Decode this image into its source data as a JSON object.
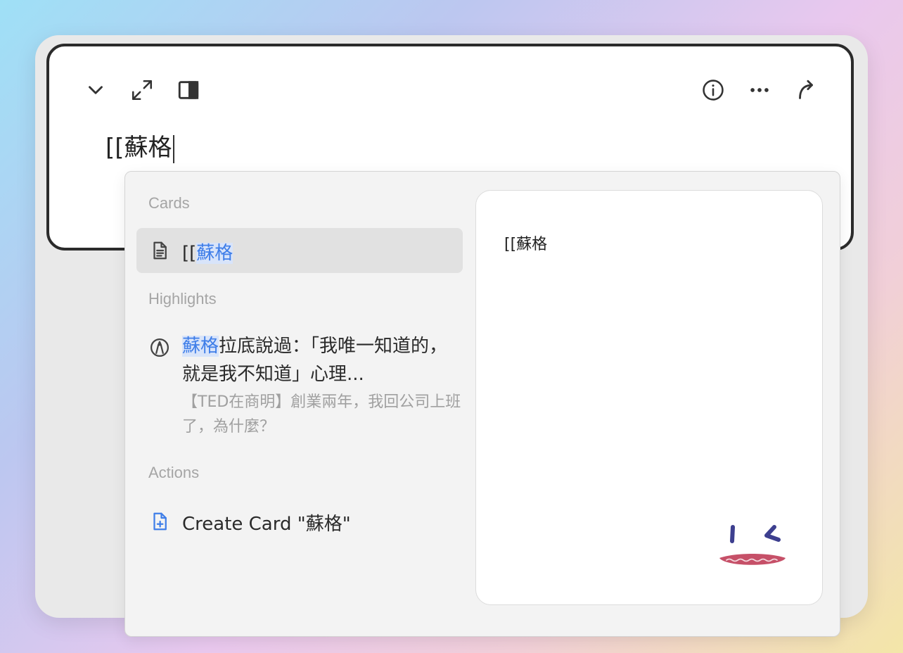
{
  "editor": {
    "text": "[[蘇格",
    "toolbar": {
      "collapse_icon": "chevron-down-icon",
      "expand_icon": "expand-icon",
      "sidebar_icon": "sidebar-panel-icon",
      "info_icon": "info-icon",
      "more_icon": "more-dots-icon",
      "share_icon": "share-arrow-icon"
    }
  },
  "popup": {
    "sections": {
      "cards": "Cards",
      "highlights": "Highlights",
      "actions": "Actions"
    },
    "card_result": {
      "prefix": "[[",
      "match": "蘇格",
      "icon": "document-icon"
    },
    "highlight_result": {
      "match": "蘇格",
      "text": "拉底說過：「我唯一知道的，就是我不知道」心理...",
      "source": "【TED在商明】創業兩年，我回公司上班了，為什麼？",
      "icon": "highlighter-icon"
    },
    "action": {
      "label": "Create Card \"蘇格\"",
      "icon": "add-document-icon"
    },
    "preview": {
      "text": "[[蘇格"
    }
  },
  "colors": {
    "accent": "#3f7ee8",
    "highlight_bg": "#d8e4fa",
    "mascot_eye": "#3d3f8f",
    "mascot_mouth": "#c65068"
  }
}
